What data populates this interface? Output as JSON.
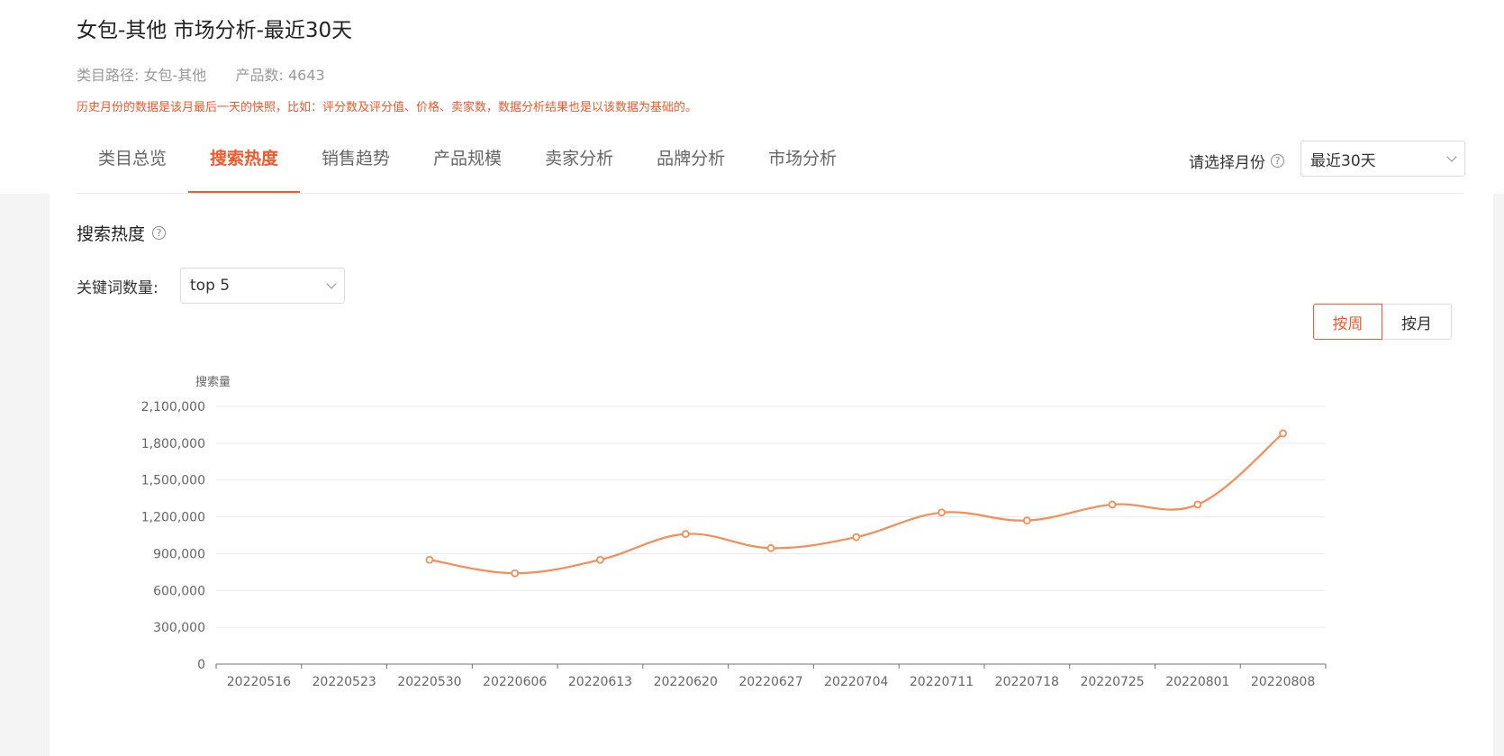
{
  "header": {
    "title": "女包-其他 市场分析-最近30天",
    "path_label": "类目路径:",
    "path_value": "女包-其他",
    "count_label": "产品数:",
    "count_value": "4643",
    "notice": "历史月份的数据是该月最后一天的快照，比如：评分数及评分值、价格、卖家数，数据分析结果也是以该数据为基础的。"
  },
  "tabs": [
    {
      "label": "类目总览",
      "active": false
    },
    {
      "label": "搜索热度",
      "active": true
    },
    {
      "label": "销售趋势",
      "active": false
    },
    {
      "label": "产品规模",
      "active": false
    },
    {
      "label": "卖家分析",
      "active": false
    },
    {
      "label": "品牌分析",
      "active": false
    },
    {
      "label": "市场分析",
      "active": false
    }
  ],
  "month_selector": {
    "label": "请选择月份",
    "value": "最近30天"
  },
  "section": {
    "title": "搜索热度",
    "keyword_label": "关键词数量:",
    "keyword_value": "top 5"
  },
  "period_toggle": {
    "week_label": "按周",
    "month_label": "按月",
    "active": "week"
  },
  "colors": {
    "accent": "#f5582a",
    "line": "#f78d54"
  },
  "chart_data": {
    "type": "line",
    "ylabel": "搜索量",
    "ylim": [
      0,
      2100000
    ],
    "yticks": [
      0,
      300000,
      600000,
      900000,
      1200000,
      1500000,
      1800000,
      2100000
    ],
    "ytick_labels": [
      "0",
      "300,000",
      "600,000",
      "900,000",
      "1,200,000",
      "1,500,000",
      "1,800,000",
      "2,100,000"
    ],
    "categories": [
      "20220516",
      "20220523",
      "20220530",
      "20220606",
      "20220613",
      "20220620",
      "20220627",
      "20220704",
      "20220711",
      "20220718",
      "20220725",
      "20220801",
      "20220808"
    ],
    "values": [
      null,
      null,
      850000,
      740000,
      850000,
      1060000,
      945000,
      1035000,
      1235000,
      1170000,
      1300000,
      1300000,
      1880000
    ],
    "grid": true,
    "legend": "none"
  }
}
